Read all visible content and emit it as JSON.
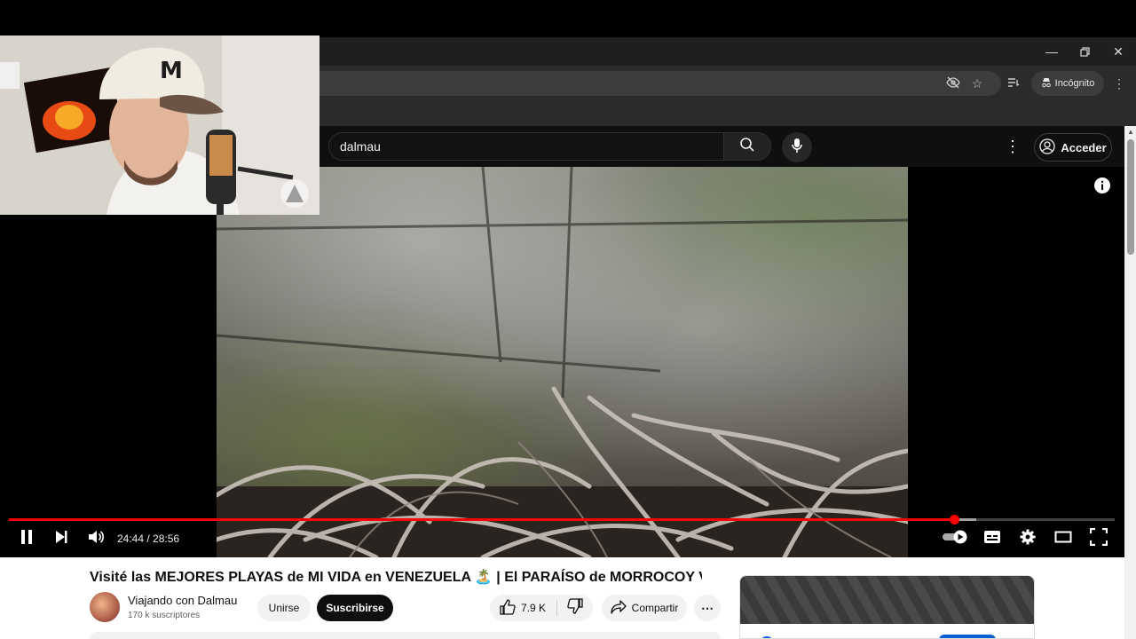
{
  "browser": {
    "incognito_label": "Incógnito",
    "window_buttons": [
      "minimize-icon",
      "restore-icon",
      "close-icon"
    ]
  },
  "masthead": {
    "search_value": "dalmau",
    "signin_label": "Acceder"
  },
  "player": {
    "time": "24:44 / 28:56",
    "progress": 0.8545,
    "buffered": 0.875,
    "state": "playing"
  },
  "video": {
    "title": "Visité las MEJORES PLAYAS de MI VIDA en VENEZUELA 🏝️ | El PARAÍSO de MORROCOY VE",
    "channel_name": "Viajando con Dalmau",
    "subscribers": "170 k suscriptores",
    "join_label": "Unirse",
    "subscribe_label": "Suscribirse",
    "likes": "7.9 K",
    "share_label": "Compartir"
  },
  "colors": {
    "accent": "#ff0000",
    "yt_dark": "#0f0f0f",
    "link_blue": "#065fd4"
  }
}
